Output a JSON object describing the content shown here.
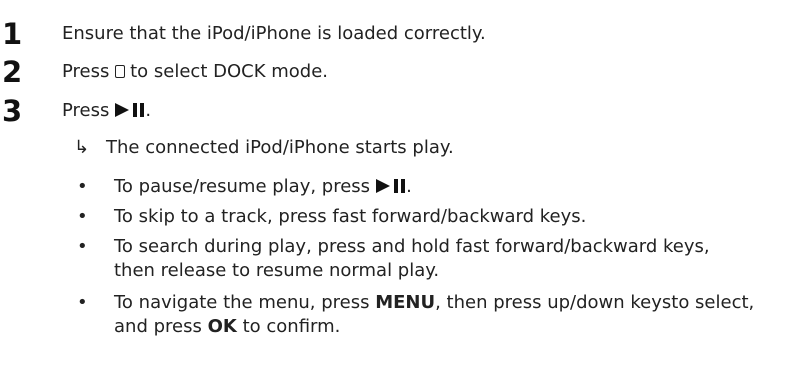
{
  "steps": [
    {
      "number": "1",
      "text": "Ensure that the iPod/iPhone is loaded correctly."
    },
    {
      "number": "2",
      "text_before": "Press",
      "text_after": "to select DOCK mode.",
      "icon": "dock-icon"
    },
    {
      "number": "3",
      "text": "Press",
      "icon": "play-pause-icon",
      "text_after": "."
    }
  ],
  "result": {
    "arrow": "↳",
    "text": "The connected iPod/iPhone starts play."
  },
  "bullets": [
    {
      "text": "To pause/resume play, press",
      "icon": "play-pause-icon",
      "text_after": "."
    },
    {
      "text": "To skip to a track, press fast forward/backward keys."
    },
    {
      "text": "To search during play, press and hold fast forward/backward keys, then release to resume normal play."
    },
    {
      "text_1": "To navigate the menu, press",
      "keyword_1": "MENU",
      "text_2": ", then press up/down keysto select, and press",
      "keyword_2": "OK",
      "text_3": "to confirm."
    }
  ],
  "bullet_char": "•"
}
